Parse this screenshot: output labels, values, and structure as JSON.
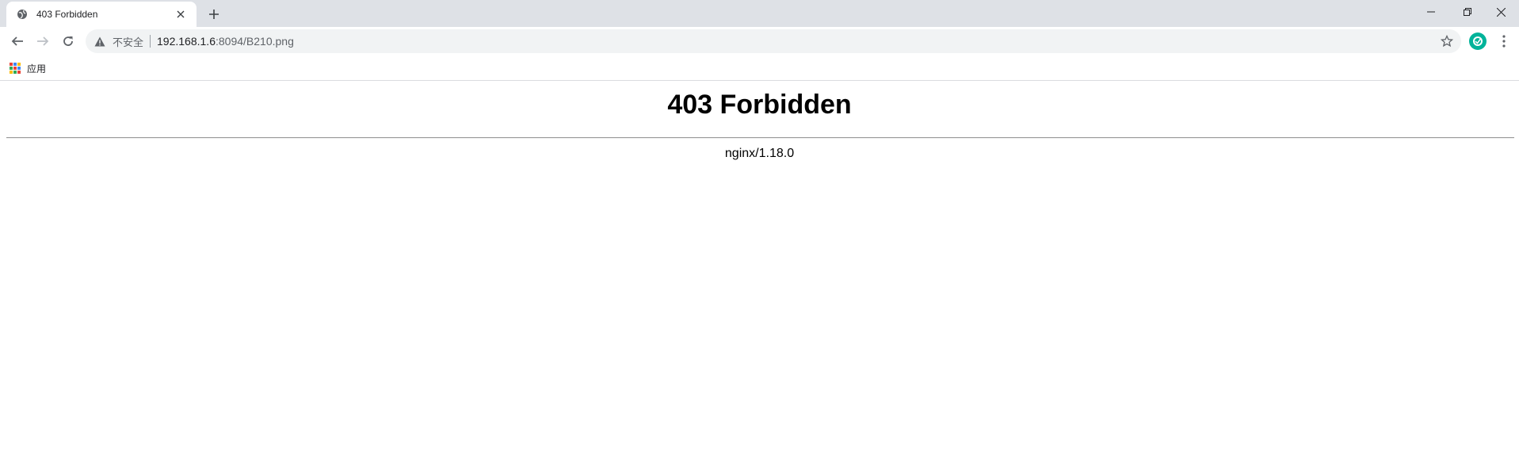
{
  "tab": {
    "title": "403 Forbidden",
    "close": "✕",
    "new_tab": "+"
  },
  "window_controls": {
    "minimize": "minimize-icon",
    "restore": "restore-icon",
    "close": "close-icon"
  },
  "toolbar": {
    "security_label": "不安全",
    "url_host": "192.168.1.6",
    "url_path": ":8094/B210.png"
  },
  "bookmarks": {
    "apps_label": "应用"
  },
  "page": {
    "heading": "403 Forbidden",
    "server": "nginx/1.18.0"
  },
  "colors": {
    "extension_accent": "#00b39a",
    "chrome_frame": "#dee1e6"
  }
}
